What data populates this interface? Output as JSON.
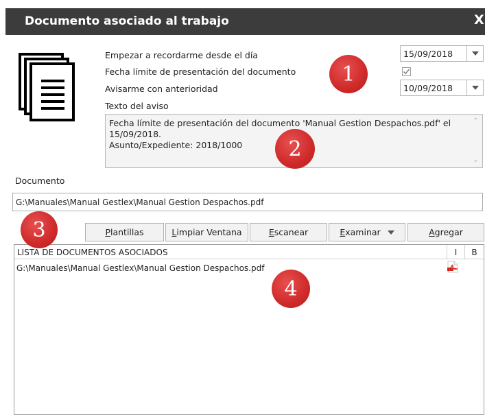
{
  "window": {
    "title": "Documento asociado al trabajo",
    "close_label": "X"
  },
  "reminder": {
    "start_label": "Empezar a recordarme desde el día",
    "start_date": "15/09/2018",
    "deadline_label": "Fecha límite de presentación del documento",
    "deadline_checked": true,
    "advance_label": "Avisarme con anterioridad",
    "advance_date": "10/09/2018",
    "notice_text_label": "Texto del aviso",
    "notice_text_lines": [
      "Fecha límite de presentación del documento 'Manual Gestion Despachos.pdf' el",
      "15/09/2018.",
      "Asunto/Expediente: 2018/1000"
    ]
  },
  "document": {
    "label": "Documento",
    "path": "G:\\Manuales\\Manual Gestlex\\Manual Gestion Despachos.pdf"
  },
  "buttons": {
    "templates": {
      "first": "P",
      "rest": "lantillas"
    },
    "clear": {
      "first": "L",
      "rest": "impiar Ventana"
    },
    "scan": {
      "first": "E",
      "rest": "scanear"
    },
    "browse": {
      "first": "E",
      "rest": "xaminar"
    },
    "add": {
      "first": "A",
      "rest": "gregar"
    }
  },
  "list": {
    "header_title": "LISTA DE DOCUMENTOS ASOCIADOS",
    "col_i": "I",
    "col_b": "B",
    "rows": [
      {
        "path": "G:\\Manuales\\Manual Gestlex\\Manual Gestion Despachos.pdf",
        "icon": "pdf-icon"
      }
    ]
  },
  "badges": [
    "1",
    "2",
    "3",
    "4"
  ],
  "colors": {
    "titlebar": "#3c3c3c",
    "badge": "#cf2a2a",
    "pdf_red": "#d8261f"
  }
}
